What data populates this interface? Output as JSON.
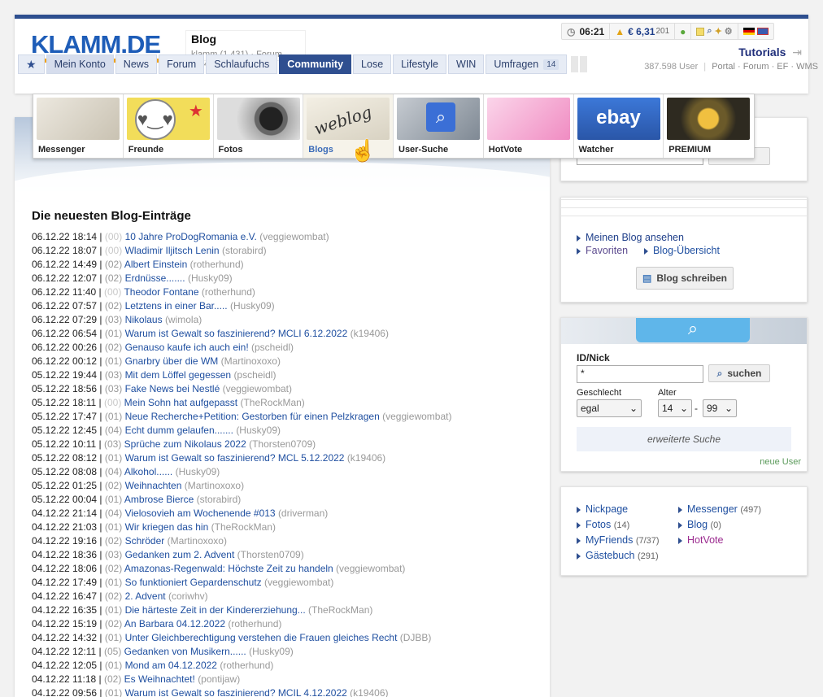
{
  "header": {
    "logo": "KLAMM.DE",
    "blog_title": "Blog",
    "blog_sub": "klamm (1.431) · Forum (104)",
    "time": "06:21",
    "money_main": "€ 6,31",
    "money_small": "201",
    "tutorials": "Tutorials"
  },
  "nav": {
    "tabs": [
      {
        "label": "★"
      },
      {
        "label": "Mein Konto"
      },
      {
        "label": "News"
      },
      {
        "label": "Forum"
      },
      {
        "label": "Schlaufuchs"
      },
      {
        "label": "Community"
      },
      {
        "label": "Lose"
      },
      {
        "label": "Lifestyle"
      },
      {
        "label": "WIN"
      },
      {
        "label": "Umfragen"
      }
    ],
    "umfragen_badge": "14",
    "user_count": "387.598 User",
    "links": "Portal · Forum · EF · WMS"
  },
  "submenu": [
    {
      "label": "Messenger",
      "color": "#d9d4c8"
    },
    {
      "label": "Freunde",
      "color": "#f0d850"
    },
    {
      "label": "Fotos",
      "color": "#555555"
    },
    {
      "label": "Blogs",
      "color": "#e8e4da"
    },
    {
      "label": "User-Suche",
      "color": "#9aa3ad"
    },
    {
      "label": "HotVote",
      "color": "#f3b4d6"
    },
    {
      "label": "Watcher",
      "color": "#2f66c9"
    },
    {
      "label": "PREMIUM",
      "color": "#6a5a30"
    }
  ],
  "main": {
    "heading": "Die neuesten Blog-Einträge",
    "entries": [
      {
        "date": "06.12.22 18:14",
        "num": "(00)",
        "title": "10 Jahre ProDogRomania e.V.",
        "user": "(veggiewombat)"
      },
      {
        "date": "06.12.22 18:07",
        "num": "(00)",
        "title": "Wladimir Iljitsch Lenin",
        "user": "(storabird)"
      },
      {
        "date": "06.12.22 14:49",
        "num": "(02)",
        "title": "Albert Einstein",
        "user": "(rotherhund)"
      },
      {
        "date": "06.12.22 12:07",
        "num": "(02)",
        "title": "Erdnüsse.......",
        "user": "(Husky09)"
      },
      {
        "date": "06.12.22 11:40",
        "num": "(00)",
        "title": "Theodor Fontane",
        "user": "(rotherhund)"
      },
      {
        "date": "06.12.22 07:57",
        "num": "(02)",
        "title": "Letztens in einer Bar.....",
        "user": "(Husky09)"
      },
      {
        "date": "06.12.22 07:29",
        "num": "(03)",
        "title": "Nikolaus",
        "user": "(wimola)"
      },
      {
        "date": "06.12.22 06:54",
        "num": "(01)",
        "title": "Warum ist Gewalt so faszinierend? MCLI 6.12.2022",
        "user": "(k19406)"
      },
      {
        "date": "06.12.22 00:26",
        "num": "(02)",
        "title": "Genauso kaufe ich auch ein!",
        "user": "(pscheidl)"
      },
      {
        "date": "06.12.22 00:12",
        "num": "(01)",
        "title": "Gnarbry über die WM",
        "user": "(Martinoxoxo)"
      },
      {
        "date": "05.12.22 19:44",
        "num": "(03)",
        "title": "Mit dem Löffel gegessen",
        "user": "(pscheidl)"
      },
      {
        "date": "05.12.22 18:56",
        "num": "(03)",
        "title": "Fake News bei Nestlé",
        "user": "(veggiewombat)"
      },
      {
        "date": "05.12.22 18:11",
        "num": "(00)",
        "title": "Mein Sohn hat aufgepasst",
        "user": "(TheRockMan)"
      },
      {
        "date": "05.12.22 17:47",
        "num": "(01)",
        "title": "Neue Recherche+Petition: Gestorben für einen Pelzkragen",
        "user": "(veggiewombat)"
      },
      {
        "date": "05.12.22 12:45",
        "num": "(04)",
        "title": "Echt dumm gelaufen.......",
        "user": "(Husky09)"
      },
      {
        "date": "05.12.22 10:11",
        "num": "(03)",
        "title": "Sprüche zum Nikolaus 2022",
        "user": "(Thorsten0709)"
      },
      {
        "date": "05.12.22 08:12",
        "num": "(01)",
        "title": "Warum ist Gewalt so faszinierend? MCL 5.12.2022",
        "user": "(k19406)"
      },
      {
        "date": "05.12.22 08:08",
        "num": "(04)",
        "title": "Alkohol......",
        "user": "(Husky09)"
      },
      {
        "date": "05.12.22 01:25",
        "num": "(02)",
        "title": "Weihnachten",
        "user": "(Martinoxoxo)"
      },
      {
        "date": "05.12.22 00:04",
        "num": "(01)",
        "title": "Ambrose Bierce",
        "user": "(storabird)"
      },
      {
        "date": "04.12.22 21:14",
        "num": "(04)",
        "title": "Vielosovieh am Wochenende #013",
        "user": "(driverman)"
      },
      {
        "date": "04.12.22 21:03",
        "num": "(01)",
        "title": "Wir kriegen das hin",
        "user": "(TheRockMan)"
      },
      {
        "date": "04.12.22 19:16",
        "num": "(02)",
        "title": "Schröder",
        "user": "(Martinoxoxo)"
      },
      {
        "date": "04.12.22 18:36",
        "num": "(03)",
        "title": "Gedanken zum 2. Advent",
        "user": "(Thorsten0709)"
      },
      {
        "date": "04.12.22 18:06",
        "num": "(02)",
        "title": "Amazonas-Regenwald: Höchste Zeit zu handeln",
        "user": "(veggiewombat)"
      },
      {
        "date": "04.12.22 17:49",
        "num": "(01)",
        "title": "So funktioniert Gepardenschutz",
        "user": "(veggiewombat)"
      },
      {
        "date": "04.12.22 16:47",
        "num": "(02)",
        "title": "2. Advent",
        "user": "(coriwhv)"
      },
      {
        "date": "04.12.22 16:35",
        "num": "(01)",
        "title": "Die härteste Zeit in der Kindererziehung...",
        "user": "(TheRockMan)"
      },
      {
        "date": "04.12.22 15:19",
        "num": "(02)",
        "title": "An Barbara 04.12.2022",
        "user": "(rotherhund)"
      },
      {
        "date": "04.12.22 14:32",
        "num": "(01)",
        "title": "Unter Gleichberechtigung verstehen die Frauen gleiches Recht",
        "user": "(DJBB)"
      },
      {
        "date": "04.12.22 12:11",
        "num": "(05)",
        "title": "Gedanken von Musikern......",
        "user": "(Husky09)"
      },
      {
        "date": "04.12.22 12:05",
        "num": "(01)",
        "title": "Mond am 04.12.2022",
        "user": "(rotherhund)"
      },
      {
        "date": "04.12.22 11:18",
        "num": "(02)",
        "title": "Es Weihnachtet!",
        "user": "(pontijaw)"
      },
      {
        "date": "04.12.22 09:56",
        "num": "(01)",
        "title": "Warum ist Gewalt so faszinierend? MCIL 4.12.2022",
        "user": "(k19406)"
      }
    ]
  },
  "blogbox": {
    "links": [
      "Meinen Blog ansehen",
      "Favoriten",
      "Blog-Übersicht"
    ],
    "write_button": "Blog schreiben"
  },
  "search": {
    "idnick_label": "ID/Nick",
    "idnick_value": "*",
    "search_button": "suchen",
    "gender_label": "Geschlecht",
    "gender_value": "egal",
    "age_label": "Alter",
    "age_from": "14",
    "age_sep": "-",
    "age_to": "99",
    "advanced": "erweiterte Suche",
    "new_user": "neue User"
  },
  "quicklinks": {
    "left": [
      {
        "label": "Nickpage",
        "count": ""
      },
      {
        "label": "Fotos",
        "count": "(14)"
      },
      {
        "label": "MyFriends",
        "count": "(7/37)"
      },
      {
        "label": "Gästebuch",
        "count": "(291)"
      }
    ],
    "right": [
      {
        "label": "Messenger",
        "count": "(497)"
      },
      {
        "label": "Blog",
        "count": "(0)"
      },
      {
        "label": "HotVote",
        "count": ""
      }
    ]
  }
}
